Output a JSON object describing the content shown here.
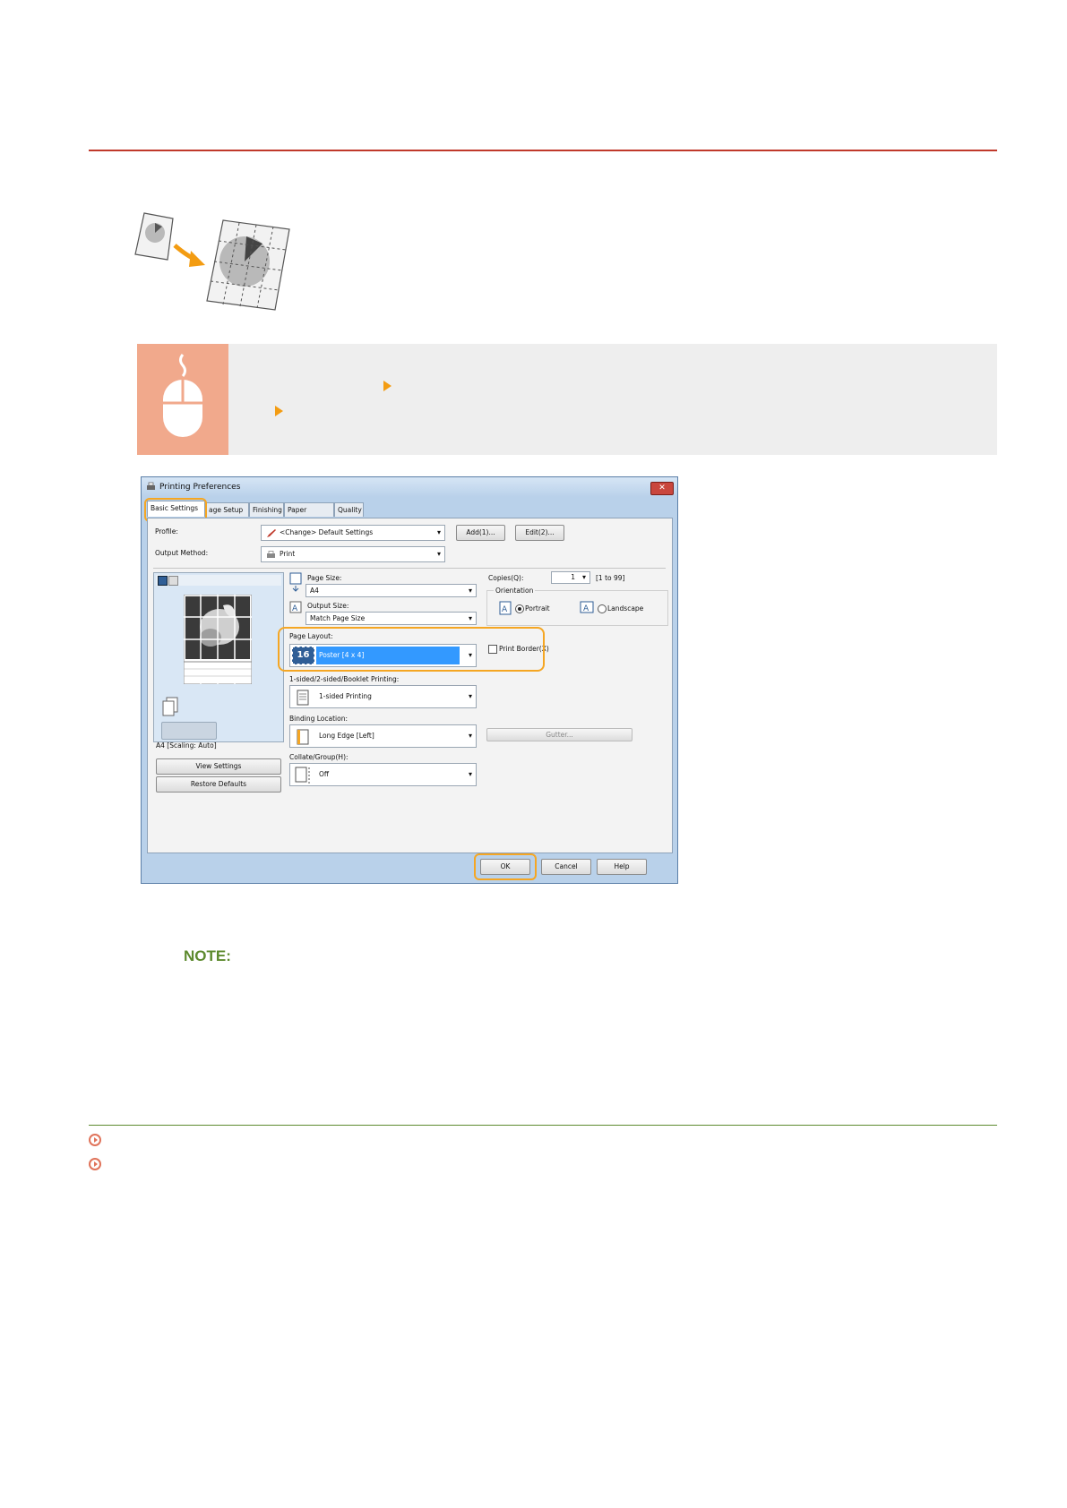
{
  "dialog": {
    "title": "Printing Preferences",
    "close_glyph": "✕",
    "tabs": [
      {
        "label": "Basic Settings"
      },
      {
        "label": "age Setup"
      },
      {
        "label": "Finishing"
      },
      {
        "label": "Paper Source"
      },
      {
        "label": "Quality"
      }
    ],
    "profile": {
      "label": "Profile:",
      "value": "<Change> Default Settings",
      "add_button": "Add(1)...",
      "edit_button": "Edit(2)..."
    },
    "output_method": {
      "label": "Output Method:",
      "value": "Print"
    },
    "preview_caption": "A4 [Scaling: Auto]",
    "page_size": {
      "label": "Page Size:",
      "value": "A4"
    },
    "output_size": {
      "label": "Output Size:",
      "value": "Match Page Size"
    },
    "copies": {
      "label": "Copies(Q):",
      "value": "1",
      "range": "[1 to 99]"
    },
    "orientation": {
      "label": "Orientation",
      "portrait": "Portrait",
      "landscape": "Landscape",
      "selected": "Portrait"
    },
    "page_layout": {
      "label": "Page Layout:",
      "value": "Poster [4 x 4]",
      "badge": "16"
    },
    "print_border": {
      "label": "Print Border(X)",
      "checked": false
    },
    "sided_printing": {
      "label": "1-sided/2-sided/Booklet Printing:",
      "value": "1-sided Printing"
    },
    "binding_location": {
      "label": "Binding Location:",
      "value": "Long Edge [Left]"
    },
    "gutter_button": "Gutter...",
    "collate": {
      "label": "Collate/Group(H):",
      "value": "Off"
    },
    "view_settings_button": "View Settings",
    "restore_defaults_button": "Restore Defaults",
    "ok_button": "OK",
    "cancel_button": "Cancel",
    "help_button": "Help"
  },
  "note": {
    "label": "NOTE:"
  },
  "colors": {
    "accent_red": "#c0392b",
    "highlight_orange": "#f5a623",
    "note_green": "#5d8a2e",
    "band_gray": "#eeeeee",
    "icon_salmon": "#f1a98c"
  }
}
